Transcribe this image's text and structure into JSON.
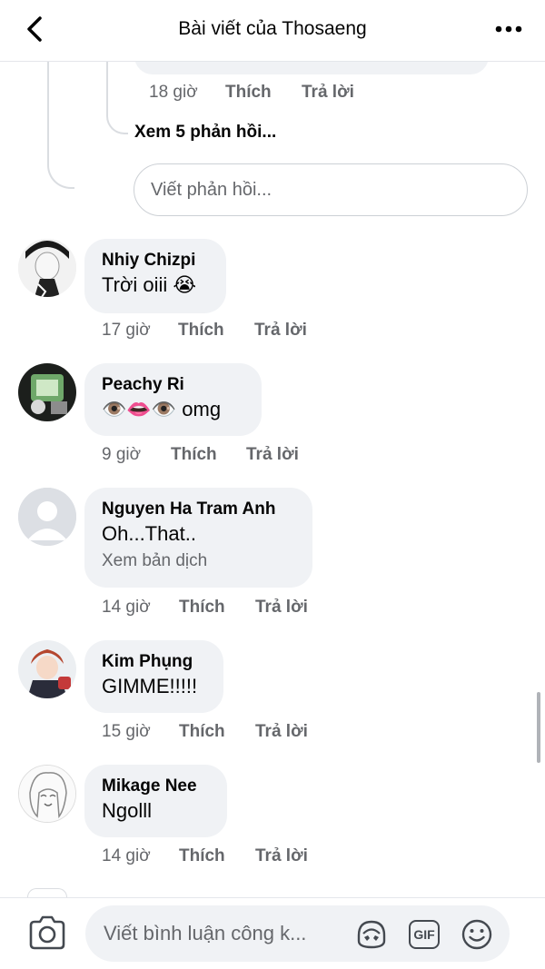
{
  "header": {
    "title": "Bài viết của Thosaeng",
    "back_icon": "chevron-left-icon",
    "more_icon": "more-horizontal-icon"
  },
  "thread": {
    "reply_actions": {
      "time": "18 giờ",
      "like": "Thích",
      "reply": "Trả lời"
    },
    "see_replies": "Xem 5 phản hồi...",
    "reply_placeholder": "Viết phản hồi..."
  },
  "comments": [
    {
      "name": "Nhiy Chizpi",
      "text": "Trời oiii 😭",
      "time": "17 giờ",
      "like": "Thích",
      "reply": "Trả lời"
    },
    {
      "name": "Peachy Ri",
      "text": "👁️👄👁️ omg",
      "time": "9 giờ",
      "like": "Thích",
      "reply": "Trả lời"
    },
    {
      "name": "Nguyen Ha Tram Anh",
      "text": "Oh...That..",
      "translate": "Xem bản dịch",
      "time": "14 giờ",
      "like": "Thích",
      "reply": "Trả lời"
    },
    {
      "name": "Kim Phụng",
      "text": "GIMME!!!!!",
      "time": "15 giờ",
      "like": "Thích",
      "reply": "Trả lời"
    },
    {
      "name": "Mikage Nee",
      "text": "Ngolll",
      "time": "14 giờ",
      "like": "Thích",
      "reply": "Trả lời"
    }
  ],
  "composer": {
    "placeholder": "Viết bình luận công k...",
    "camera_icon": "camera-icon",
    "avatar_sticker_icon": "avatar-sticker-icon",
    "gif_label": "GIF",
    "emoji_icon": "emoji-icon"
  },
  "colors": {
    "bubble": "#f0f2f5",
    "secondary_text": "#65676b",
    "primary_text": "#050505"
  }
}
